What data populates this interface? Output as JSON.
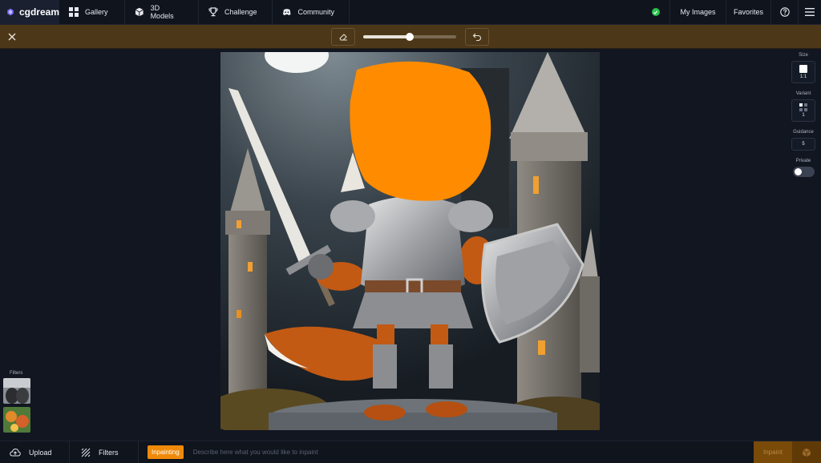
{
  "app": {
    "brand": "cgdream"
  },
  "nav": {
    "gallery": "Gallery",
    "models": "3D Models",
    "challenge": "Challenge",
    "community": "Community"
  },
  "header": {
    "my_images": "My Images",
    "favorites": "Favorites"
  },
  "toolbar": {
    "brush_size_fraction": 0.5
  },
  "settings": {
    "size_label": "Size",
    "size_value": "1:1",
    "variant_label": "Variant",
    "variant_value": "1",
    "guidance_label": "Guidance",
    "guidance_value": "5",
    "private_label": "Private",
    "private_on": false
  },
  "filters_panel": {
    "label": "Filters"
  },
  "bottom": {
    "upload": "Upload",
    "filters": "Filters",
    "mode": "Inpainting",
    "prompt_placeholder": "Describe here what you would like to inpaint",
    "inpaint": "Inpaint"
  },
  "colors": {
    "accent": "#f08a0a",
    "toolbar_bg": "#4c3718",
    "mask": "#ff8c00",
    "status_ok": "#27c24c"
  }
}
